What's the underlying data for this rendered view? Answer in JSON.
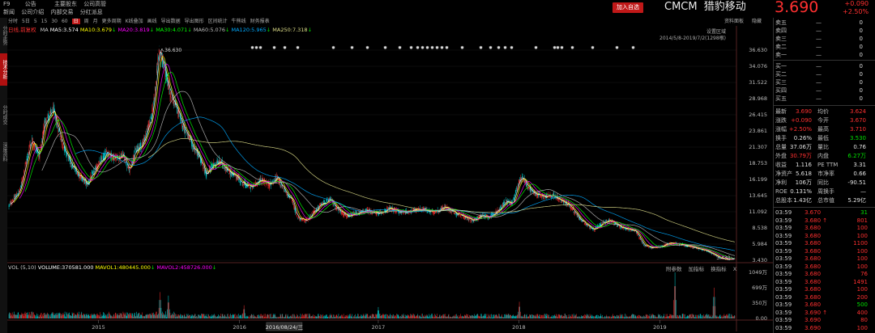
{
  "header": {
    "code": "F9",
    "row1": [
      "公告",
      "主要股东",
      "公司高管"
    ],
    "row2": [
      "新闻",
      "公司介绍",
      "内部交易",
      "分红派息"
    ],
    "add_button": "加入自选",
    "ticker": "CMCM",
    "name": "猎豹移动",
    "price": "3.690",
    "change": "+0.090",
    "change_pct": "+2.50%"
  },
  "left_tabs": [
    "分时走势",
    "技术分析",
    "分时成交",
    "深度资料"
  ],
  "toolbar": {
    "items": [
      "分时",
      "5日",
      "5",
      "15",
      "30",
      "60",
      "日",
      "周",
      "月",
      "更多周期",
      "K线叠加",
      "画线",
      "导出数据",
      "导出图形",
      "区间统计",
      "牛熊线",
      "财务报表"
    ],
    "selected": "日",
    "right": "资料面板",
    "right2": "隐藏"
  },
  "ma": {
    "label": "日线,前复权",
    "ma_label": "MA",
    "ma5": "MA5:3.574",
    "ma10": "MA10:3.679",
    "ma20": "MA20:3.819",
    "ma30": "MA30:4.071",
    "ma60": "MA60:5.076",
    "ma120": "MA120:5.965",
    "ma250": "MA250:7.318",
    "arrow_down": "↓",
    "settings": "设置区域",
    "range_note": "2014/5/8-2019/7/2(1298根)"
  },
  "price_axis": [
    "36.630",
    "34.076",
    "31.522",
    "28.968",
    "26.415",
    "23.861",
    "21.307",
    "18.753",
    "16.199",
    "13.645",
    "11.092",
    "8.538",
    "5.984",
    "3.430"
  ],
  "high_label": "36.630",
  "low_label": "3.430",
  "volume": {
    "label": "VOL (5,10)",
    "vol": "VOLUME:370581.000",
    "mavol1": "MAVOL1:480445.000",
    "mavol2": "MAVOL2:458726.000",
    "buttons": [
      "附参数",
      "加指标",
      "换指标",
      "X"
    ],
    "axis": [
      "1049万",
      "699万",
      "350万",
      "0.00"
    ]
  },
  "x_axis": {
    "labels": [
      "2015",
      "2016",
      "2017",
      "2018",
      "2019"
    ],
    "cursor_date": "2016/08/24/三"
  },
  "colors": {
    "up": "#ff3030",
    "down": "#00d8d8",
    "ma5": "#ffffff",
    "ma10": "#ffff00",
    "ma20": "#ff00ff",
    "ma30": "#00ff00",
    "ma60": "#bbbbbb",
    "ma120": "#00aaff",
    "ma250": "#dddd88",
    "green_text": "#00e000"
  },
  "orderbook": {
    "asks": [
      {
        "label": "卖五",
        "price": "—",
        "vol": "0"
      },
      {
        "label": "卖四",
        "price": "—",
        "vol": "0"
      },
      {
        "label": "卖三",
        "price": "—",
        "vol": "0"
      },
      {
        "label": "卖二",
        "price": "—",
        "vol": "0"
      },
      {
        "label": "卖一",
        "price": "—",
        "vol": "0"
      }
    ],
    "bids": [
      {
        "label": "买一",
        "price": "—",
        "vol": "0"
      },
      {
        "label": "买二",
        "price": "—",
        "vol": "0"
      },
      {
        "label": "买三",
        "price": "—",
        "vol": "0"
      },
      {
        "label": "买四",
        "price": "—",
        "vol": "0"
      },
      {
        "label": "买五",
        "price": "—",
        "vol": "0"
      }
    ]
  },
  "quote": [
    {
      "l1": "最新",
      "v1": "3.690",
      "c1": "up",
      "l2": "均价",
      "v2": "3.624",
      "c2": "up"
    },
    {
      "l1": "涨跌",
      "v1": "+0.090",
      "c1": "up",
      "l2": "今开",
      "v2": "3.670",
      "c2": "up"
    },
    {
      "l1": "涨幅",
      "v1": "+2.50%",
      "c1": "up",
      "l2": "最高",
      "v2": "3.710",
      "c2": "up"
    },
    {
      "l1": "换手",
      "v1": "0.26%",
      "c1": "white",
      "l2": "最低",
      "v2": "3.530",
      "c2": "green"
    },
    {
      "l1": "总量",
      "v1": "37.06万",
      "c1": "white",
      "l2": "量比",
      "v2": "0.76",
      "c2": "white"
    },
    {
      "l1": "外盘",
      "v1": "30.79万",
      "c1": "up",
      "l2": "内盘",
      "v2": "6.27万",
      "c2": "green"
    },
    {
      "l1": "收益",
      "v1": "1.116",
      "c1": "white",
      "l2": "PE TTM",
      "v2": "3.31",
      "c2": "white"
    },
    {
      "l1": "净资产",
      "v1": "5.618",
      "c1": "white",
      "l2": "市净率",
      "v2": "0.66",
      "c2": "white"
    },
    {
      "l1": "净利",
      "v1": "106万",
      "c1": "white",
      "l2": "同比",
      "v2": "-90.51",
      "c2": "white"
    },
    {
      "l1": "ROE",
      "v1": "0.131%",
      "c1": "white",
      "l2": "周换手",
      "v2": "—",
      "c2": "white"
    },
    {
      "l1": "总股本",
      "v1": "1.43亿",
      "c1": "white",
      "l2": "总市值",
      "v2": "5.29亿",
      "c2": "white"
    }
  ],
  "ticks": [
    {
      "t": "03:59",
      "p": "3.670",
      "v": "31",
      "mark": "",
      "vc": "green"
    },
    {
      "t": "03:59",
      "p": "3.680",
      "v": "801",
      "mark": "↑",
      "vc": "up"
    },
    {
      "t": "03:59",
      "p": "3.680",
      "v": "100",
      "mark": "",
      "vc": "up"
    },
    {
      "t": "03:59",
      "p": "3.680",
      "v": "100",
      "mark": "",
      "vc": "up"
    },
    {
      "t": "03:59",
      "p": "3.680",
      "v": "1100",
      "mark": "",
      "vc": "up"
    },
    {
      "t": "03:59",
      "p": "3.680",
      "v": "100",
      "mark": "",
      "vc": "up"
    },
    {
      "t": "03:59",
      "p": "3.680",
      "v": "100",
      "mark": "",
      "vc": "up"
    },
    {
      "t": "03:59",
      "p": "3.680",
      "v": "100",
      "mark": "",
      "vc": "up"
    },
    {
      "t": "03:59",
      "p": "3.680",
      "v": "76",
      "mark": "",
      "vc": "up"
    },
    {
      "t": "03:59",
      "p": "3.680",
      "v": "1491",
      "mark": "",
      "vc": "up"
    },
    {
      "t": "03:59",
      "p": "3.680",
      "v": "100",
      "mark": "",
      "vc": "up"
    },
    {
      "t": "03:59",
      "p": "3.680",
      "v": "200",
      "mark": "",
      "vc": "up"
    },
    {
      "t": "03:59",
      "p": "3.680",
      "v": "500",
      "mark": "",
      "vc": "green"
    },
    {
      "t": "03:59",
      "p": "3.690",
      "v": "400",
      "mark": "↑",
      "vc": "up"
    },
    {
      "t": "03:59",
      "p": "3.690",
      "v": "80",
      "mark": "",
      "vc": "up"
    },
    {
      "t": "03:59",
      "p": "3.690",
      "v": "100",
      "mark": "",
      "vc": "up"
    }
  ],
  "chart_data": {
    "type": "candlestick",
    "title": "",
    "date_range": "2014/5/8-2019/7/2",
    "bar_count": 1298,
    "ylim": [
      3.43,
      36.63
    ],
    "volume_ylim": [
      0,
      1049
    ],
    "volume_unit": "万",
    "x_labels": [
      "2015",
      "2016",
      "2017",
      "2018",
      "2019"
    ],
    "x_label_positions_bar_index": [
      160,
      412,
      660,
      911,
      1163
    ],
    "close_path": [
      [
        0,
        12.0
      ],
      [
        20,
        14.5
      ],
      [
        40,
        22.5
      ],
      [
        55,
        20.0
      ],
      [
        65,
        25.5
      ],
      [
        80,
        27.0
      ],
      [
        95,
        22.0
      ],
      [
        110,
        19.0
      ],
      [
        125,
        17.0
      ],
      [
        140,
        15.5
      ],
      [
        160,
        18.5
      ],
      [
        175,
        20.5
      ],
      [
        190,
        19.5
      ],
      [
        205,
        20.0
      ],
      [
        215,
        17.5
      ],
      [
        225,
        20.5
      ],
      [
        240,
        22.0
      ],
      [
        255,
        26.0
      ],
      [
        262,
        31.0
      ],
      [
        268,
        36.6
      ],
      [
        278,
        34.0
      ],
      [
        288,
        30.0
      ],
      [
        298,
        28.0
      ],
      [
        308,
        25.5
      ],
      [
        318,
        23.5
      ],
      [
        328,
        21.5
      ],
      [
        340,
        20.0
      ],
      [
        352,
        17.0
      ],
      [
        365,
        18.5
      ],
      [
        378,
        19.0
      ],
      [
        392,
        17.5
      ],
      [
        405,
        16.8
      ],
      [
        420,
        15.5
      ],
      [
        435,
        15.0
      ],
      [
        450,
        16.2
      ],
      [
        465,
        15.3
      ],
      [
        480,
        16.5
      ],
      [
        495,
        14.0
      ],
      [
        505,
        13.2
      ],
      [
        515,
        10.3
      ],
      [
        530,
        9.6
      ],
      [
        545,
        11.0
      ],
      [
        560,
        12.4
      ],
      [
        575,
        13.0
      ],
      [
        590,
        11.3
      ],
      [
        605,
        10.3
      ],
      [
        620,
        10.8
      ],
      [
        640,
        11.3
      ],
      [
        660,
        10.8
      ],
      [
        680,
        11.6
      ],
      [
        700,
        11.0
      ],
      [
        720,
        11.2
      ],
      [
        740,
        11.5
      ],
      [
        760,
        11.0
      ],
      [
        780,
        11.8
      ],
      [
        800,
        10.8
      ],
      [
        815,
        10.2
      ],
      [
        830,
        9.7
      ],
      [
        845,
        10.5
      ],
      [
        860,
        10.3
      ],
      [
        875,
        11.3
      ],
      [
        888,
        12.8
      ],
      [
        900,
        12.5
      ],
      [
        910,
        15.5
      ],
      [
        918,
        16.6
      ],
      [
        928,
        15.0
      ],
      [
        940,
        14.0
      ],
      [
        955,
        13.5
      ],
      [
        970,
        13.8
      ],
      [
        985,
        12.9
      ],
      [
        1000,
        12.3
      ],
      [
        1015,
        10.5
      ],
      [
        1030,
        9.2
      ],
      [
        1045,
        8.2
      ],
      [
        1060,
        9.3
      ],
      [
        1075,
        9.8
      ],
      [
        1090,
        8.8
      ],
      [
        1105,
        8.4
      ],
      [
        1120,
        8.0
      ],
      [
        1135,
        5.8
      ],
      [
        1150,
        5.4
      ],
      [
        1165,
        5.6
      ],
      [
        1180,
        6.1
      ],
      [
        1200,
        6.0
      ],
      [
        1220,
        5.5
      ],
      [
        1240,
        5.1
      ],
      [
        1255,
        4.6
      ],
      [
        1270,
        3.8
      ],
      [
        1285,
        3.55
      ],
      [
        1297,
        3.69
      ]
    ],
    "ma_values": {
      "MA5": 3.574,
      "MA10": 3.679,
      "MA20": 3.819,
      "MA30": 4.071,
      "MA60": 5.076,
      "MA120": 5.965,
      "MA250": 7.318
    },
    "volume_values": {
      "VOLUME": 370581,
      "MAVOL1": 480445,
      "MAVOL2": 458726
    },
    "volume_spikes": [
      [
        270,
        600
      ],
      [
        285,
        520
      ],
      [
        420,
        300
      ],
      [
        660,
        260
      ],
      [
        912,
        380
      ],
      [
        1190,
        1049
      ],
      [
        1260,
        700
      ]
    ]
  }
}
